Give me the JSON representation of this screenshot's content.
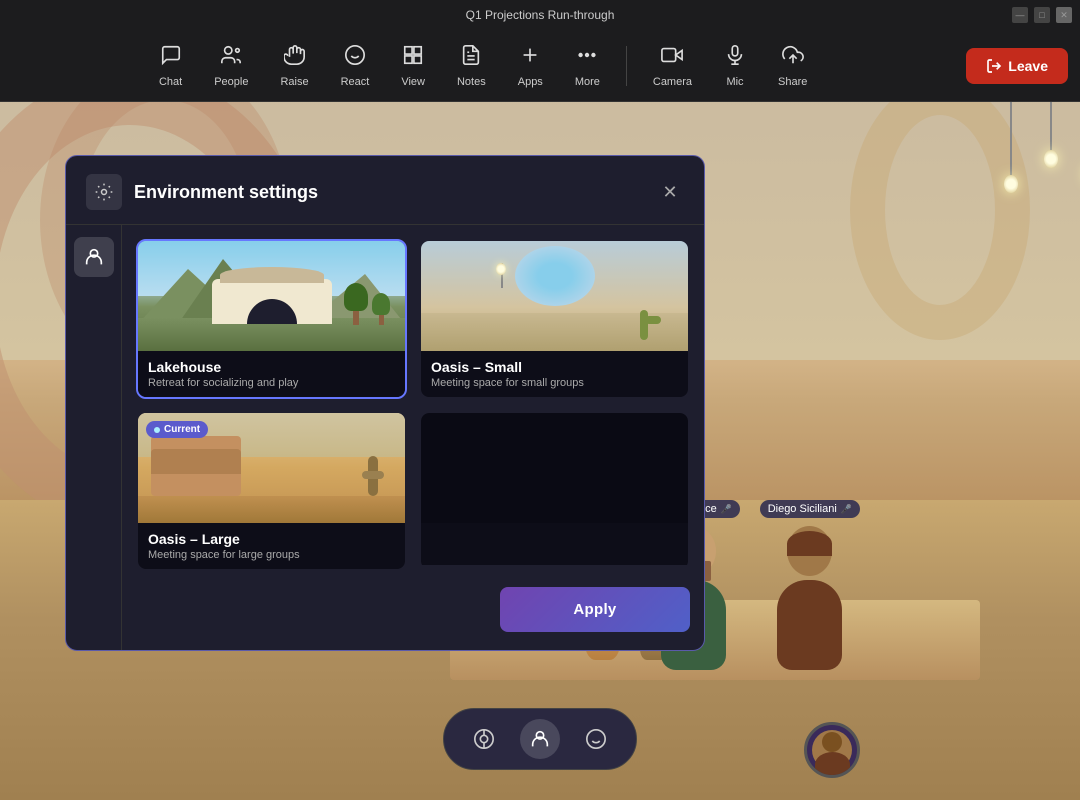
{
  "titlebar": {
    "title": "Q1 Projections Run-through",
    "controls": [
      "minimize",
      "maximize",
      "close"
    ]
  },
  "toolbar": {
    "items": [
      {
        "id": "chat",
        "label": "Chat",
        "icon": "💬"
      },
      {
        "id": "people",
        "label": "People",
        "icon": "👥"
      },
      {
        "id": "raise",
        "label": "Raise",
        "icon": "✋"
      },
      {
        "id": "react",
        "label": "React",
        "icon": "😊"
      },
      {
        "id": "view",
        "label": "View",
        "icon": "⊞"
      },
      {
        "id": "notes",
        "label": "Notes",
        "icon": "📋"
      },
      {
        "id": "apps",
        "label": "Apps",
        "icon": "➕"
      },
      {
        "id": "more",
        "label": "More",
        "icon": "•••"
      }
    ],
    "right_items": [
      {
        "id": "camera",
        "label": "Camera",
        "icon": "📷"
      },
      {
        "id": "mic",
        "label": "Mic",
        "icon": "🎤"
      },
      {
        "id": "share",
        "label": "Share",
        "icon": "⬆"
      }
    ],
    "leave_label": "Leave"
  },
  "panel": {
    "title": "Environment settings",
    "icon": "🎭",
    "close_icon": "✕",
    "environments": [
      {
        "id": "lakehouse",
        "name": "Lakehouse",
        "desc": "Retreat for socializing and play",
        "selected": true,
        "current": false,
        "type": "lakehouse"
      },
      {
        "id": "oasis-small",
        "name": "Oasis – Small",
        "desc": "Meeting space for small groups",
        "selected": false,
        "current": false,
        "type": "oasis-small"
      },
      {
        "id": "oasis-large",
        "name": "Oasis – Large",
        "desc": "Meeting space for large groups",
        "selected": false,
        "current": true,
        "type": "oasis-large"
      },
      {
        "id": "empty",
        "name": "",
        "desc": "",
        "selected": false,
        "current": false,
        "type": "empty"
      }
    ],
    "apply_label": "Apply",
    "current_label": "Current"
  },
  "avatars": [
    {
      "name": "Adele Vance",
      "color": "#3a6040",
      "head_color": "#c8a070"
    },
    {
      "name": "Diego Siciliani",
      "color": "#6b3a20",
      "head_color": "#a07848"
    }
  ],
  "bottom_bar": {
    "buttons": [
      {
        "id": "env",
        "icon": "🎭",
        "active": false
      },
      {
        "id": "avatar",
        "icon": "🤖",
        "active": true
      },
      {
        "id": "react",
        "icon": "😊",
        "active": false
      }
    ]
  }
}
